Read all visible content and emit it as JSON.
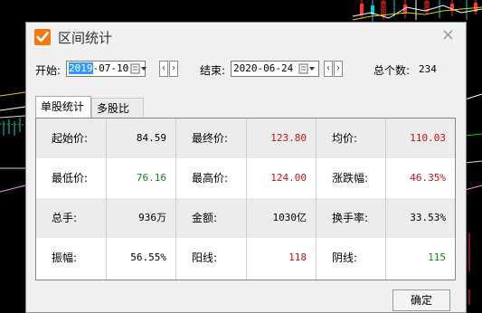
{
  "dialog": {
    "title": "区间统计",
    "close_glyph": "×",
    "start_label": "开始:",
    "start_date_selected": "2019",
    "start_date_rest": "-07-10",
    "end_label": "结束:",
    "end_date": "2020-06-24",
    "prev_glyph": "‹",
    "next_glyph": "›",
    "total_label": "总个数:",
    "total_value": "234",
    "ok_label": "确定"
  },
  "tabs": [
    {
      "label": "单股统计",
      "active": true
    },
    {
      "label": "多股比较",
      "active": false
    }
  ],
  "stats": [
    [
      {
        "label": "起始价:",
        "value": "84.59",
        "color": "#000000"
      },
      {
        "label": "最终价:",
        "value": "123.80",
        "color": "#c0141a"
      },
      {
        "label": "均价:",
        "value": "110.03",
        "color": "#c0141a"
      }
    ],
    [
      {
        "label": "最低价:",
        "value": "76.16",
        "color": "#148a14"
      },
      {
        "label": "最高价:",
        "value": "124.00",
        "color": "#c0141a"
      },
      {
        "label": "涨跌幅:",
        "value": "46.35%",
        "color": "#c0141a"
      }
    ],
    [
      {
        "label": "总手:",
        "value": "936万",
        "color": "#000000"
      },
      {
        "label": "金额:",
        "value": "1030亿",
        "color": "#000000"
      },
      {
        "label": "换手率:",
        "value": "33.53%",
        "color": "#000000"
      }
    ],
    [
      {
        "label": "振幅:",
        "value": "56.55%",
        "color": "#000000"
      },
      {
        "label": "阳线:",
        "value": "118",
        "color": "#c0141a"
      },
      {
        "label": "阴线:",
        "value": "115",
        "color": "#148a14"
      }
    ]
  ],
  "colors": {
    "accent": "#f07a10",
    "up": "#c0141a",
    "down": "#148a14"
  },
  "icons": {
    "logo": "checkmark-icon",
    "calendar": "calendar-icon",
    "close": "close-icon"
  }
}
